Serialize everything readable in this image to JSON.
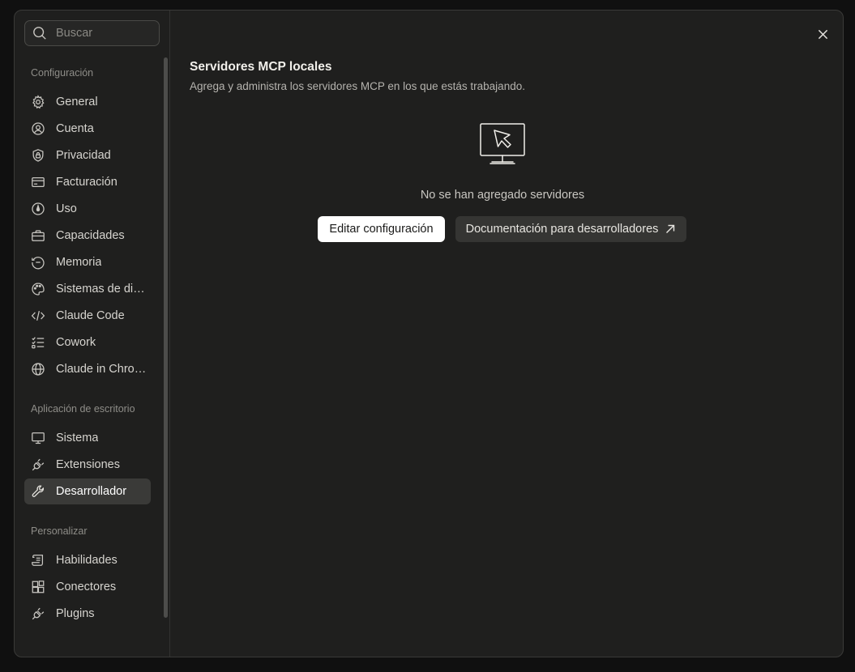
{
  "search": {
    "placeholder": "Buscar"
  },
  "sidebar": {
    "sections": [
      {
        "title": "Configuración",
        "items": [
          {
            "label": "General",
            "icon": "gear-icon"
          },
          {
            "label": "Cuenta",
            "icon": "user-circle-icon"
          },
          {
            "label": "Privacidad",
            "icon": "shield-lock-icon"
          },
          {
            "label": "Facturación",
            "icon": "credit-card-icon"
          },
          {
            "label": "Uso",
            "icon": "gauge-icon"
          },
          {
            "label": "Capacidades",
            "icon": "briefcase-icon"
          },
          {
            "label": "Memoria",
            "icon": "memory-icon"
          },
          {
            "label": "Sistemas de diseño",
            "icon": "palette-icon"
          },
          {
            "label": "Claude Code",
            "icon": "code-icon"
          },
          {
            "label": "Cowork",
            "icon": "checklist-icon"
          },
          {
            "label": "Claude in Chrome",
            "icon": "globe-icon"
          }
        ]
      },
      {
        "title": "Aplicación de escritorio",
        "items": [
          {
            "label": "Sistema",
            "icon": "monitor-icon"
          },
          {
            "label": "Extensiones",
            "icon": "plug-icon"
          },
          {
            "label": "Desarrollador",
            "icon": "wrench-icon",
            "active": true
          }
        ]
      },
      {
        "title": "Personalizar",
        "items": [
          {
            "label": "Habilidades",
            "icon": "scroll-icon"
          },
          {
            "label": "Conectores",
            "icon": "blocks-icon"
          },
          {
            "label": "Plugins",
            "icon": "plug-icon"
          }
        ]
      }
    ]
  },
  "main": {
    "title": "Servidores MCP locales",
    "subtitle": "Agrega y administra los servidores MCP en los que estás trabajando.",
    "empty_text": "No se han agregado servidores",
    "edit_button": "Editar configuración",
    "docs_button": "Documentación para desarrolladores"
  }
}
